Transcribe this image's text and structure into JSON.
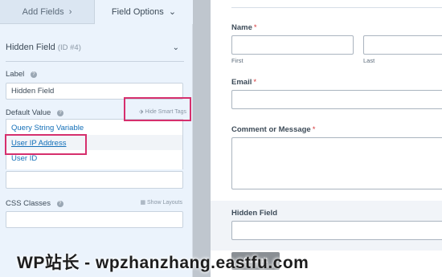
{
  "left_panel": {
    "tabs": {
      "add_fields": "Add Fields",
      "field_options": "Field Options"
    },
    "field": {
      "name": "Hidden Field",
      "id_text": "(ID #4)"
    },
    "label": {
      "title": "Label",
      "value": "Hidden Field"
    },
    "default_value": {
      "title": "Default Value",
      "smart_tags_toggle": "Hide Smart Tags"
    },
    "smart_tags": [
      "Query String Variable",
      "User IP Address",
      "User ID"
    ],
    "css_classes": {
      "title": "CSS Classes",
      "show_layouts": "Show Layouts"
    },
    "help_glyph": "?"
  },
  "form": {
    "name": {
      "label": "Name",
      "required": "*",
      "first": "First",
      "last": "Last"
    },
    "email": {
      "label": "Email",
      "required": "*"
    },
    "comment": {
      "label": "Comment or Message",
      "required": "*"
    },
    "hidden": {
      "label": "Hidden Field"
    },
    "submit": "Submit"
  },
  "watermark": "WP站长 - wpzhanzhang.eastfu.com",
  "colors": {
    "accent_link": "#136fb8",
    "highlight": "#d62f6d",
    "required": "#d63638",
    "panel_bg": "#ebf3fc"
  }
}
